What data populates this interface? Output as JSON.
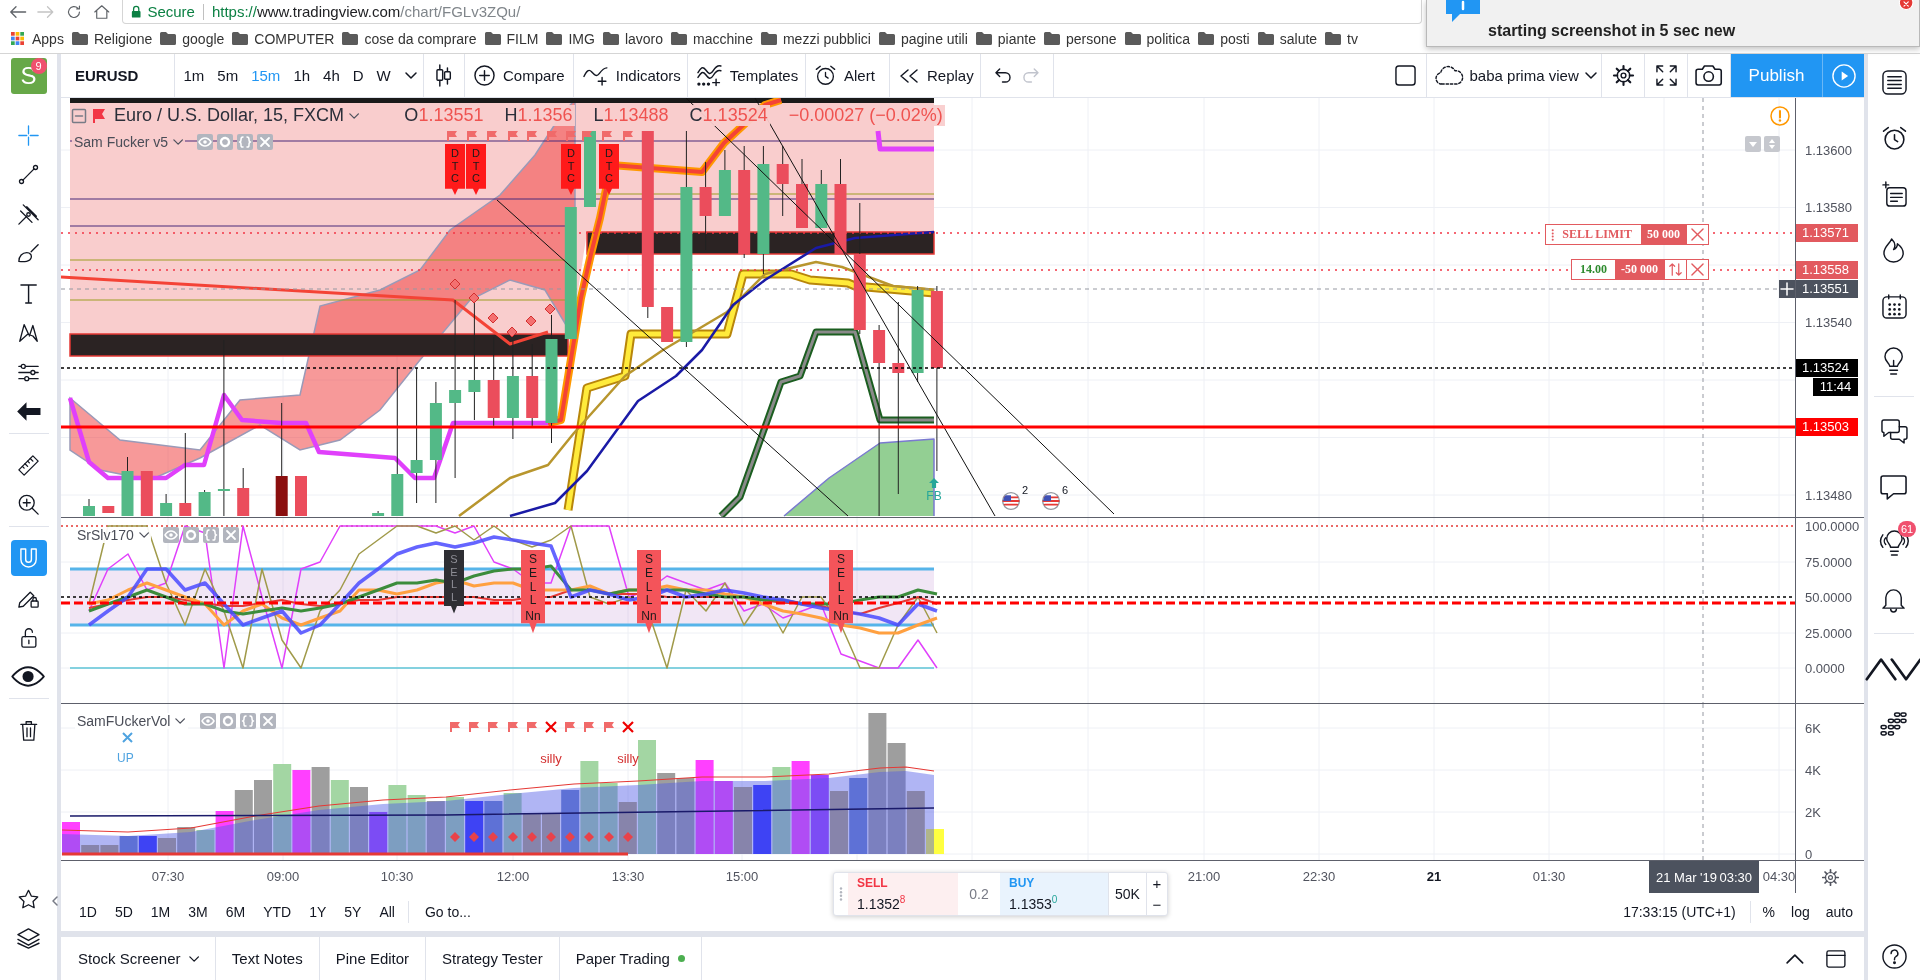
{
  "browser": {
    "nav": [
      {
        "kind": "back",
        "disabled": false
      },
      {
        "kind": "forward",
        "disabled": true
      },
      {
        "kind": "reload",
        "disabled": false
      },
      {
        "kind": "home",
        "disabled": false
      }
    ],
    "address": {
      "security": "Secure",
      "scheme": "https://",
      "host": "www.tradingview.com",
      "path": "/chart/FGLv3ZQu/"
    },
    "bookmarks": [
      {
        "kind": "apps",
        "label": "Apps"
      },
      {
        "kind": "folder",
        "label": "Religione"
      },
      {
        "kind": "folder",
        "label": "google"
      },
      {
        "kind": "folder",
        "label": "COMPUTER"
      },
      {
        "kind": "folder",
        "label": "cose da comprare"
      },
      {
        "kind": "folder",
        "label": "FILM"
      },
      {
        "kind": "folder",
        "label": "IMG"
      },
      {
        "kind": "folder",
        "label": "lavoro"
      },
      {
        "kind": "folder",
        "label": "macchine"
      },
      {
        "kind": "folder",
        "label": "mezzi pubblici"
      },
      {
        "kind": "folder",
        "label": "pagine utili"
      },
      {
        "kind": "folder",
        "label": "piante"
      },
      {
        "kind": "folder",
        "label": "persone"
      },
      {
        "kind": "folder",
        "label": "politica"
      },
      {
        "kind": "folder",
        "label": "posti"
      },
      {
        "kind": "folder",
        "label": "salute"
      },
      {
        "kind": "folder",
        "label": "tv"
      }
    ],
    "notification": {
      "text": "starting screenshot in 5 sec new"
    }
  },
  "header": {
    "avatar": {
      "letter": "S",
      "badge": "9"
    },
    "symbol": "EURUSD",
    "intervals": [
      {
        "label": "1m",
        "selected": false
      },
      {
        "label": "5m",
        "selected": false
      },
      {
        "label": "15m",
        "selected": true
      },
      {
        "label": "1h",
        "selected": false
      },
      {
        "label": "4h",
        "selected": false
      },
      {
        "label": "D",
        "selected": false
      },
      {
        "label": "W",
        "selected": false
      }
    ],
    "actions": [
      {
        "kind": "compare",
        "label": "Compare"
      },
      {
        "kind": "indicators",
        "label": "Indicators"
      },
      {
        "kind": "templates",
        "label": "Templates"
      },
      {
        "kind": "alert",
        "label": "Alert"
      },
      {
        "kind": "replay",
        "label": "Replay"
      }
    ],
    "history": [
      {
        "kind": "undo",
        "disabled": false
      },
      {
        "kind": "redo",
        "disabled": true
      }
    ],
    "layout": "baba prima view",
    "publish": "Publish"
  },
  "drawing_tools": {
    "groups": [
      {
        "tools": [
          {
            "kind": "crosshair",
            "active": true
          },
          {
            "kind": "trend_line",
            "active": false
          },
          {
            "kind": "pitchfork",
            "active": false
          },
          {
            "kind": "brush",
            "active": false
          },
          {
            "kind": "text",
            "active": false
          },
          {
            "kind": "pattern",
            "active": false
          },
          {
            "kind": "forecast",
            "active": false
          },
          {
            "kind": "remove",
            "active": false
          }
        ]
      },
      {
        "tools": [
          {
            "kind": "ruler",
            "active": false
          },
          {
            "kind": "zoom",
            "active": false
          }
        ]
      },
      {
        "tools": [
          {
            "kind": "magnet",
            "active": true
          },
          {
            "kind": "lock_drawings",
            "active": false
          },
          {
            "kind": "unlock",
            "active": false
          },
          {
            "kind": "eye",
            "active": false
          }
        ]
      },
      {
        "tools": [
          {
            "kind": "trash",
            "active": false
          }
        ]
      }
    ],
    "bottom": [
      {
        "kind": "star"
      },
      {
        "kind": "layers"
      }
    ]
  },
  "chart": {
    "main": {
      "legend": {
        "title": "Euro / U.S. Dollar, 15, FXCM",
        "ohlc": [
          {
            "label": "O",
            "value": "1.13551"
          },
          {
            "label": "H",
            "value": "1.1356"
          },
          {
            "label": "L",
            "value": "1.13488"
          },
          {
            "label": "C",
            "value": "1.13524"
          }
        ],
        "change": "−0.00027 (−0.02%)"
      },
      "indicator": "Sam Fucker v5",
      "axis_ticks": [
        "1.13600",
        "1.13580",
        "1.13540",
        "1.13480"
      ],
      "price_tags": [
        {
          "kind": "order",
          "value": "1.13571"
        },
        {
          "kind": "order",
          "value": "1.13558"
        },
        {
          "kind": "crosshair",
          "value": "1.13551"
        },
        {
          "kind": "last",
          "value": "1.13524"
        },
        {
          "kind": "countdown",
          "value": "11:44"
        },
        {
          "kind": "level",
          "value": "1.13503"
        }
      ],
      "orders": [
        {
          "kind": "limit",
          "label": "SELL LIMIT",
          "quantity": "50 000"
        },
        {
          "kind": "position",
          "profit": "14.00",
          "quantity": "-50 000"
        }
      ],
      "signals": [
        {
          "text": "DTC"
        },
        {
          "text": "DTC"
        },
        {
          "text": "DTC"
        },
        {
          "text": "DTC"
        }
      ],
      "breakout": "FB",
      "events": [
        {
          "count": "2"
        },
        {
          "count": "6"
        }
      ]
    },
    "oscillator": {
      "name": "SrSlv170",
      "axis_ticks": [
        "100.0000",
        "75.0000",
        "50.0000",
        "25.0000",
        "0.0000"
      ],
      "signals": [
        {
          "kind": "dark",
          "text": "SELL"
        },
        {
          "kind": "sell",
          "text": "SELL",
          "note": "Nn"
        },
        {
          "kind": "sell",
          "text": "SELL",
          "note": "Nn"
        },
        {
          "kind": "sell",
          "text": "SELL",
          "note": "Nn"
        }
      ]
    },
    "volume": {
      "name": "SamFUckerVol",
      "axis_ticks": [
        "6K",
        "4K",
        "2K",
        "0"
      ],
      "trend": "UP",
      "notes": [
        "silly",
        "silly"
      ]
    },
    "time_axis": {
      "ticks": [
        {
          "label": "07:30",
          "major": false
        },
        {
          "label": "09:00",
          "major": false
        },
        {
          "label": "10:30",
          "major": false
        },
        {
          "label": "12:00",
          "major": false
        },
        {
          "label": "13:30",
          "major": false
        },
        {
          "label": "15:00",
          "major": false
        },
        {
          "label": "21:00",
          "major": false
        },
        {
          "label": "22:30",
          "major": false
        },
        {
          "label": "21",
          "major": true
        },
        {
          "label": "01:30",
          "major": false
        },
        {
          "label": "04:30",
          "major": false
        }
      ],
      "crosshair": {
        "date": "21 Mar '19",
        "time": "03:30"
      }
    },
    "trade": {
      "sell": {
        "label": "SELL",
        "price": "1.1352$^{8}$"
      },
      "spread": "0.2",
      "buy": {
        "label": "BUY",
        "price": "1.1353$^{0}$"
      },
      "quantity": "50K",
      "steps": [
        "+",
        "−"
      ]
    }
  },
  "range_bar": {
    "ranges": [
      "1D",
      "5D",
      "1M",
      "3M",
      "6M",
      "YTD",
      "1Y",
      "5Y",
      "All"
    ],
    "goto": "Go to...",
    "clock": "17:33:15 (UTC+1)",
    "scales": [
      "%",
      "log",
      "auto"
    ]
  },
  "bottom_panel": {
    "tabs": [
      {
        "label": "Stock Screener",
        "kind": "menu"
      },
      {
        "label": "Text Notes",
        "kind": "plain"
      },
      {
        "label": "Pine Editor",
        "kind": "plain"
      },
      {
        "label": "Strategy Tester",
        "kind": "plain"
      },
      {
        "label": "Paper Trading",
        "kind": "status"
      }
    ]
  },
  "sidebar": {
    "groups": [
      {
        "items": [
          {
            "kind": "menu"
          },
          {
            "kind": "alarm"
          },
          {
            "kind": "watchlist"
          },
          {
            "kind": "hotlist"
          },
          {
            "kind": "calendar"
          },
          {
            "kind": "ideas"
          }
        ]
      },
      {
        "items": [
          {
            "kind": "chat"
          },
          {
            "kind": "messages"
          },
          {
            "kind": "streams",
            "badge": "61"
          },
          {
            "kind": "notifications"
          }
        ]
      },
      {
        "items": [
          {
            "kind": "order_panel"
          },
          {
            "kind": "depth"
          }
        ]
      }
    ],
    "footer": [
      {
        "kind": "help"
      }
    ]
  }
}
